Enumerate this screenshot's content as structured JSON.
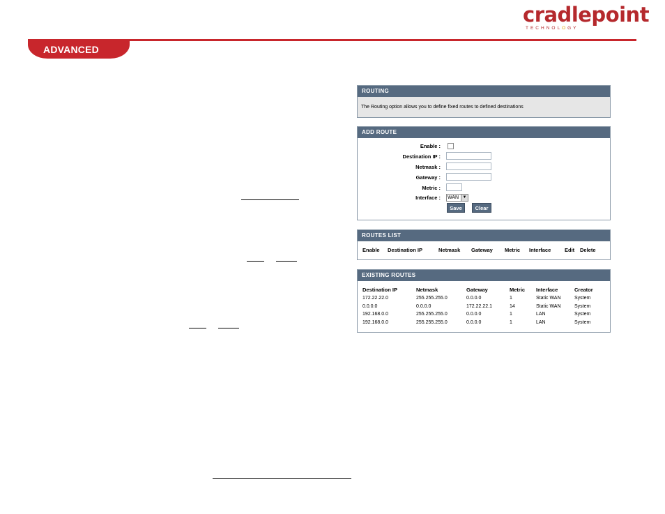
{
  "brand": {
    "word": "cradlepoint",
    "sub_pre": "TECHNOL",
    "sub_o": "O",
    "sub_post": "GY",
    "color": "#c8262c"
  },
  "section_tab": "ADVANCED",
  "routing": {
    "title": "ROUTING",
    "description": "The Routing option allows you to define fixed routes to defined destinations"
  },
  "add_route": {
    "title": "ADD ROUTE",
    "labels": {
      "enable": "Enable :",
      "destination_ip": "Destination IP :",
      "netmask": "Netmask :",
      "gateway": "Gateway :",
      "metric": "Metric :",
      "interface": "Interface :"
    },
    "values": {
      "destination_ip": "",
      "netmask": "",
      "gateway": "",
      "metric": "",
      "interface": "WAN",
      "enable": false
    },
    "save": "Save",
    "clear": "Clear"
  },
  "routes_list": {
    "title": "ROUTES LIST",
    "columns": [
      "Enable",
      "Destination IP",
      "Netmask",
      "Gateway",
      "Metric",
      "Interface",
      "Edit",
      "Delete"
    ]
  },
  "existing_routes": {
    "title": "EXISTING ROUTES",
    "columns": [
      "Destination IP",
      "Netmask",
      "Gateway",
      "Metric",
      "Interface",
      "Creator"
    ],
    "rows": [
      [
        "172.22.22.0",
        "255.255.255.0",
        "0.0.0.0",
        "1",
        "Static WAN",
        "System"
      ],
      [
        "0.0.0.0",
        "0.0.0.0",
        "172.22.22.1",
        "14",
        "Static WAN",
        "System"
      ],
      [
        "192.168.0.0",
        "255.255.255.0",
        "0.0.0.0",
        "1",
        "LAN",
        "System"
      ],
      [
        "192.168.0.0",
        "255.255.255.0",
        "0.0.0.0",
        "1",
        "LAN",
        "System"
      ]
    ]
  }
}
